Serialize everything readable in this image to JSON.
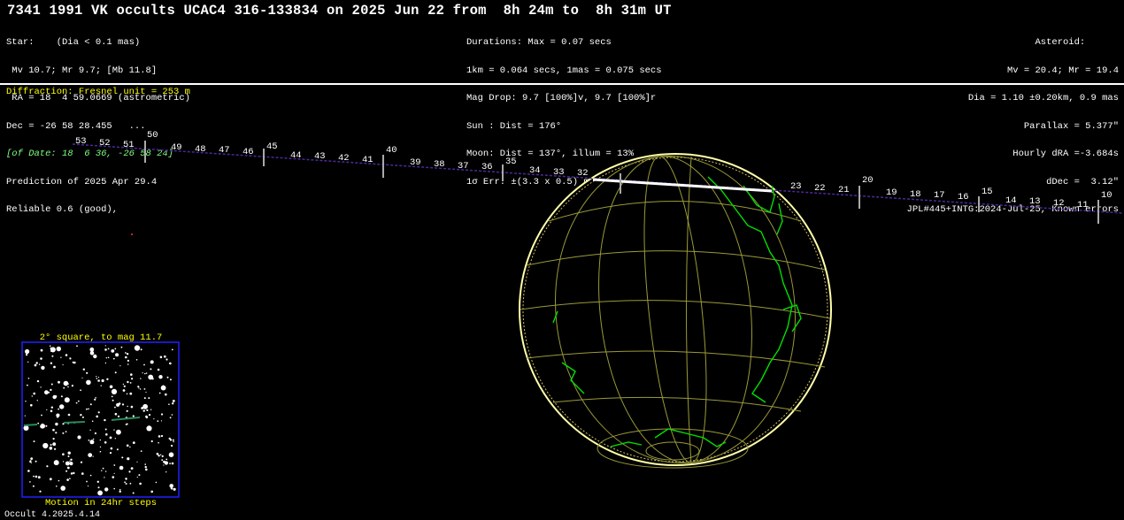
{
  "header": {
    "title": "7341 1991 VK occults UCAC4 316-133834 on 2025 Jun 22 from  8h 24m to  8h 31m UT"
  },
  "star": [
    "Star:    (Dia < 0.1 mas)",
    " Mv 10.7; Mr 9.7; [Mb 11.8]",
    " RA = 18  4 59.0669 (astrometric)",
    "Dec = -26 58 28.455   ...",
    "[of Date: 18  6 36, -26 58 24]",
    "Prediction of 2025 Apr 29.4",
    "Reliable 0.6 (good),"
  ],
  "durations": [
    "Durations: Max = 0.07 secs",
    "1km = 0.064 secs, 1mas = 0.075 secs",
    "Mag Drop: 9.7 [100%]v, 9.7 [100%]r",
    "Sun : Dist = 176°",
    "Moon: Dist = 137°, illum = 13%",
    "1σ Err: ±(3.3 x 0.5) mas in PA 44°"
  ],
  "asteroid": [
    "Asteroid:      ",
    "Mv = 20.4; Mr = 19.4",
    "Dia = 1.10 ±0.20km, 0.9 mas",
    "Parallax = 5.377\"",
    "Hourly dRA =-3.684s",
    "dDec =  3.12\"",
    "JPL#445+INTG:2024-Jul-25, Known errors"
  ],
  "diffraction": "Diffraction: Fresnel unit = 253 m",
  "path_ticks_left": [
    "53",
    "52",
    "51",
    "50",
    "49",
    "48",
    "47",
    "46",
    "45",
    "44",
    "43",
    "42",
    "41",
    "40",
    "39",
    "38",
    "37",
    "36",
    "35",
    "34",
    "33",
    "32"
  ],
  "path_ticks_right": [
    "23",
    "22",
    "21",
    "20",
    "19",
    "18",
    "17",
    "16",
    "15",
    "14",
    "13",
    "12",
    "11",
    "10"
  ],
  "finder": {
    "title": "2° square, to mag 11.7",
    "caption": "Motion in 24hr steps"
  },
  "version": "Occult 4.2025.4.14",
  "colors": {
    "background": "#000000",
    "text": "#ffffff",
    "highlight": "#ffff00",
    "italic_green": "#7fff7f",
    "grid": "#9a9a3a",
    "coast": "#00ff00",
    "path": "#4b2a9a",
    "finder_border": "#0000ff"
  }
}
